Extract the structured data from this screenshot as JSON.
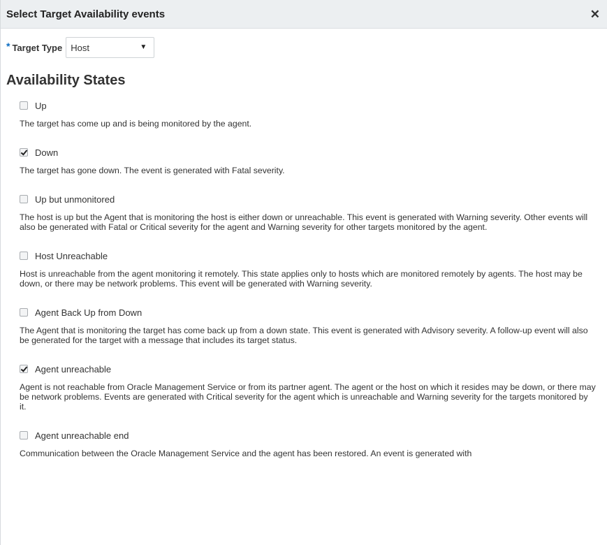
{
  "dialog": {
    "title": "Select Target Availability events",
    "close_icon": "close-icon"
  },
  "target_type": {
    "required_marker": "*",
    "label": "Target Type",
    "selected": "Host",
    "arrow": "▼"
  },
  "section_title": "Availability States",
  "states": [
    {
      "label": "Up",
      "checked": false,
      "description": "The target has come up and is being monitored by the agent."
    },
    {
      "label": "Down",
      "checked": true,
      "description": "The target has gone down. The event is generated with Fatal severity."
    },
    {
      "label": "Up but unmonitored",
      "checked": false,
      "description": "The host is up but the Agent that is monitoring the host is either down or unreachable. This event is generated with Warning severity. Other events will also be generated with Fatal or Critical severity for the agent and Warning severity for other targets monitored by the agent."
    },
    {
      "label": "Host Unreachable",
      "checked": false,
      "description": "Host is unreachable from the agent monitoring it remotely. This state applies only to hosts which are monitored remotely by agents. The host may be down, or there may be network problems. This event will be generated with Warning severity."
    },
    {
      "label": "Agent Back Up from Down",
      "checked": false,
      "description": "The Agent that is monitoring the target has come back up from a down state. This event is generated with Advisory severity. A follow-up event will also be generated for the target with a message that includes its target status."
    },
    {
      "label": "Agent unreachable",
      "checked": true,
      "description": "Agent is not reachable from Oracle Management Service or from its partner agent. The agent or the host on which it resides may be down, or there may be network problems. Events are generated with Critical severity for the agent which is unreachable and Warning severity for the targets monitored by it."
    },
    {
      "label": "Agent unreachable end",
      "checked": false,
      "description": "Communication between the Oracle Management Service and the agent has been restored. An event is generated with"
    }
  ]
}
